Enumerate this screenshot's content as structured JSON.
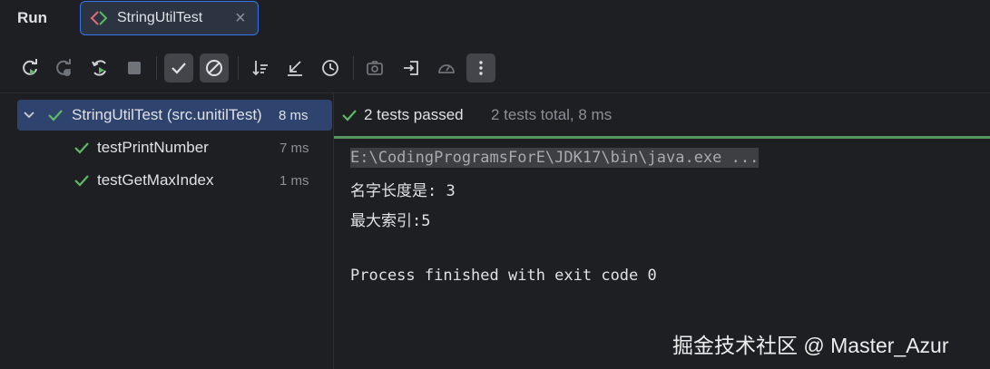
{
  "header": {
    "run_title": "Run",
    "tab_label": "StringUtilTest",
    "close_symbol": "×"
  },
  "toolbar": {
    "buttons": [
      {
        "icon": "rerun-icon"
      },
      {
        "icon": "rerun-failed-icon"
      },
      {
        "icon": "toggle-auto-test-icon"
      },
      {
        "icon": "stop-icon"
      },
      {
        "icon": "show-passed-icon",
        "active": true
      },
      {
        "icon": "show-ignored-icon",
        "active": true
      },
      {
        "icon": "sort-icon"
      },
      {
        "icon": "collapse-icon"
      },
      {
        "icon": "history-icon"
      },
      {
        "icon": "camera-icon"
      },
      {
        "icon": "import-icon"
      },
      {
        "icon": "coverage-icon"
      },
      {
        "icon": "more-icon",
        "active": true
      }
    ]
  },
  "tree": {
    "root": {
      "label": "StringUtilTest (src.unitilTest)",
      "time": "8 ms"
    },
    "children": [
      {
        "label": "testPrintNumber",
        "time": "7 ms"
      },
      {
        "label": "testGetMaxIndex",
        "time": "1 ms"
      }
    ]
  },
  "status": {
    "passed": "2 tests passed",
    "total": "2 tests total, 8 ms"
  },
  "console": {
    "lines": [
      "E:\\CodingProgramsForE\\JDK17\\bin\\java.exe ...",
      "名字长度是: 3",
      "最大索引:5",
      "",
      "Process finished with exit code 0"
    ]
  },
  "watermark": "掘金技术社区 @ Master_Azur",
  "colors": {
    "background": "#1e1f22",
    "accent": "#3574f0",
    "selection": "#2e436e",
    "pass_green": "#57965c",
    "check_green": "#5fb865"
  }
}
